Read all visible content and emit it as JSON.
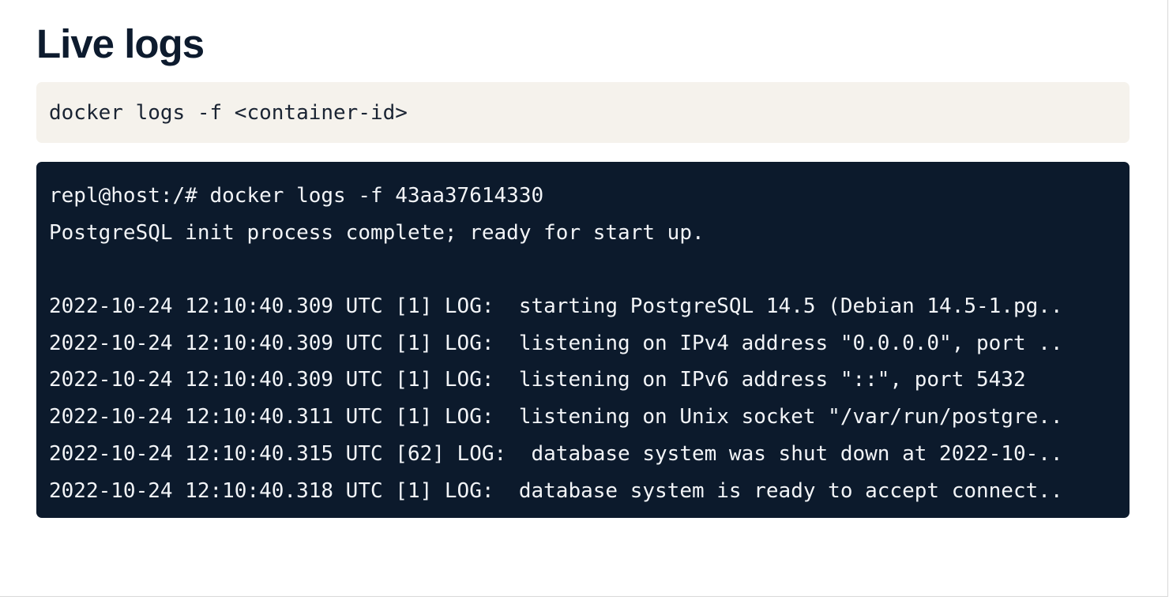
{
  "page": {
    "title": "Live logs"
  },
  "command": {
    "text": "docker logs -f <container-id>"
  },
  "terminal": {
    "lines": [
      "repl@host:/# docker logs -f 43aa37614330",
      "PostgreSQL init process complete; ready for start up.",
      "",
      "2022-10-24 12:10:40.309 UTC [1] LOG:  starting PostgreSQL 14.5 (Debian 14.5-1.pg..",
      "2022-10-24 12:10:40.309 UTC [1] LOG:  listening on IPv4 address \"0.0.0.0\", port ..",
      "2022-10-24 12:10:40.309 UTC [1] LOG:  listening on IPv6 address \"::\", port 5432",
      "2022-10-24 12:10:40.311 UTC [1] LOG:  listening on Unix socket \"/var/run/postgre..",
      "2022-10-24 12:10:40.315 UTC [62] LOG:  database system was shut down at 2022-10-..",
      "2022-10-24 12:10:40.318 UTC [1] LOG:  database system is ready to accept connect.."
    ]
  }
}
